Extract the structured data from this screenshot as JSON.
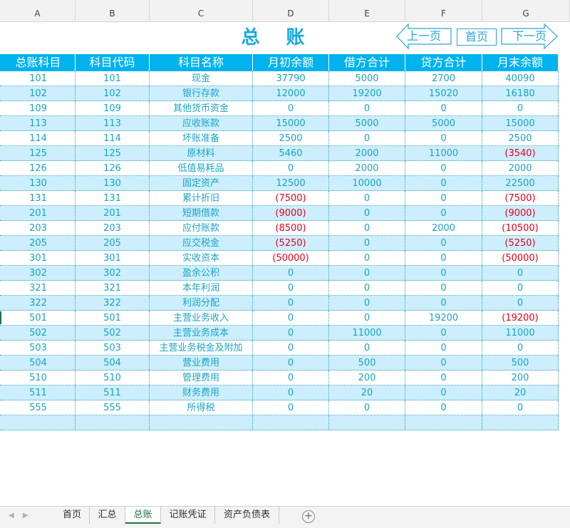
{
  "columns": [
    "A",
    "B",
    "C",
    "D",
    "E",
    "F",
    "G"
  ],
  "title": "总 账",
  "nav": {
    "prev": "上一页",
    "home": "首页",
    "next": "下一页"
  },
  "headers": [
    "总账科目",
    "科目代码",
    "科目名称",
    "月初余额",
    "借方合计",
    "贷方合计",
    "月末余额"
  ],
  "rows": [
    [
      "101",
      "101",
      "现金",
      "37790",
      "5000",
      "2700",
      "40090"
    ],
    [
      "102",
      "102",
      "银行存款",
      "12000",
      "19200",
      "15020",
      "16180"
    ],
    [
      "109",
      "109",
      "其他货币资金",
      "0",
      "0",
      "0",
      "0"
    ],
    [
      "113",
      "113",
      "应收账款",
      "15000",
      "5000",
      "5000",
      "15000"
    ],
    [
      "114",
      "114",
      "坏账准备",
      "2500",
      "0",
      "0",
      "2500"
    ],
    [
      "125",
      "125",
      "原材料",
      "5460",
      "2000",
      "11000",
      "(3540)"
    ],
    [
      "126",
      "126",
      "低值易耗品",
      "0",
      "2000",
      "0",
      "2000"
    ],
    [
      "130",
      "130",
      "固定资产",
      "12500",
      "10000",
      "0",
      "22500"
    ],
    [
      "131",
      "131",
      "累计折旧",
      "(7500)",
      "0",
      "0",
      "(7500)"
    ],
    [
      "201",
      "201",
      "短期借款",
      "(9000)",
      "0",
      "0",
      "(9000)"
    ],
    [
      "203",
      "203",
      "应付账款",
      "(8500)",
      "0",
      "2000",
      "(10500)"
    ],
    [
      "205",
      "205",
      "应交税金",
      "(5250)",
      "0",
      "0",
      "(5250)"
    ],
    [
      "301",
      "301",
      "实收资本",
      "(50000)",
      "0",
      "0",
      "(50000)"
    ],
    [
      "302",
      "302",
      "盈余公积",
      "0",
      "0",
      "0",
      "0"
    ],
    [
      "321",
      "321",
      "本年利润",
      "0",
      "0",
      "0",
      "0"
    ],
    [
      "322",
      "322",
      "利润分配",
      "0",
      "0",
      "0",
      "0"
    ],
    [
      "501",
      "501",
      "主营业务收入",
      "0",
      "0",
      "19200",
      "(19200)"
    ],
    [
      "502",
      "502",
      "主营业务成本",
      "0",
      "11000",
      "0",
      "11000"
    ],
    [
      "503",
      "503",
      "主营业务税金及附加",
      "0",
      "0",
      "0",
      "0"
    ],
    [
      "504",
      "504",
      "营业费用",
      "0",
      "500",
      "0",
      "500"
    ],
    [
      "510",
      "510",
      "管理费用",
      "0",
      "200",
      "0",
      "200"
    ],
    [
      "511",
      "511",
      "财务费用",
      "0",
      "20",
      "0",
      "20"
    ],
    [
      "555",
      "555",
      "所得税",
      "0",
      "0",
      "0",
      "0"
    ]
  ],
  "sheet_tabs": [
    "首页",
    "汇总",
    "总账",
    "记账凭证",
    "资产负债表"
  ],
  "active_tab": "总账",
  "colors": {
    "header_bg": "#00b2ee",
    "stripe": "#cdeefc",
    "text": "#1aa3c4",
    "negative": "#e8001c",
    "active_tab": "#1e7145"
  }
}
